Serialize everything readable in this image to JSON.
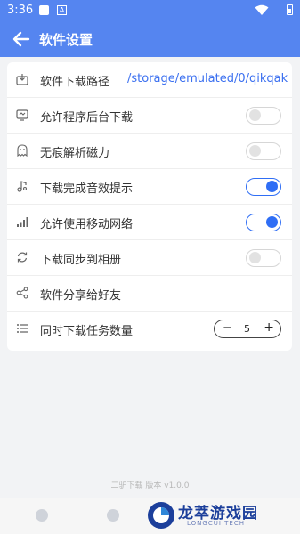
{
  "status_bar": {
    "time": "3:36",
    "badge": "A"
  },
  "app_bar": {
    "title": "软件设置"
  },
  "settings": {
    "download_path": {
      "label": "软件下载路径",
      "value": "/storage/emulated/0/qikqak"
    },
    "background_download": {
      "label": "允许程序后台下载",
      "enabled": false
    },
    "traceless_magnet": {
      "label": "无痕解析磁力",
      "enabled": false
    },
    "completion_sound": {
      "label": "下载完成音效提示",
      "enabled": true
    },
    "mobile_network": {
      "label": "允许使用移动网络",
      "enabled": true
    },
    "sync_album": {
      "label": "下载同步到相册",
      "enabled": false
    },
    "share_friends": {
      "label": "软件分享给好友"
    },
    "concurrent_tasks": {
      "label": "同时下载任务数量",
      "value": "5",
      "minus": "−",
      "plus": "+"
    }
  },
  "version_text": "二驴下载 版本 v1.0.0",
  "watermark": {
    "title": "龙萃游戏园",
    "subtitle": "LONGCUI TECH"
  },
  "colors": {
    "accent": "#5585f0",
    "toggle_on": "#2f6ef5",
    "path": "#3a6ff0"
  }
}
